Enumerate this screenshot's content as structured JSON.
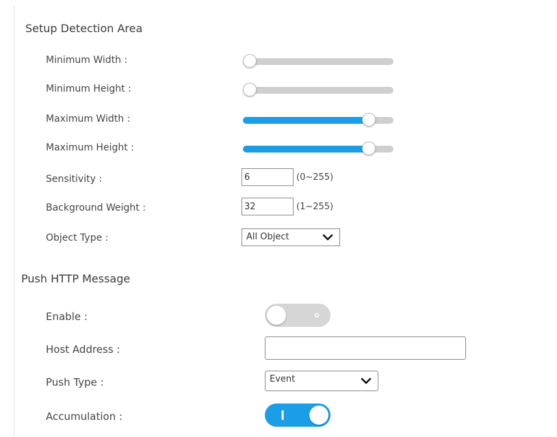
{
  "detection": {
    "title": "Setup Detection Area",
    "min_width": {
      "label": "Minimum Width :",
      "value_fraction": 0.0
    },
    "min_height": {
      "label": "Minimum Height :",
      "value_fraction": 0.0
    },
    "max_width": {
      "label": "Maximum Width :",
      "value_fraction": 0.87
    },
    "max_height": {
      "label": "Maximum Height :",
      "value_fraction": 0.87
    },
    "sensitivity": {
      "label": "Sensitivity :",
      "value": "6",
      "range": "(0~255)"
    },
    "background_weight": {
      "label": "Background Weight :",
      "value": "32",
      "range": "(1~255)"
    },
    "object_type": {
      "label": "Object Type :",
      "value": "All Object"
    }
  },
  "push_http": {
    "title": "Push HTTP Message",
    "enable": {
      "label": "Enable :",
      "state": "off"
    },
    "host_address": {
      "label": "Host Address :",
      "value": ""
    },
    "push_type": {
      "label": "Push Type :",
      "value": "Event"
    },
    "accumulation": {
      "label": "Accumulation :",
      "state": "on"
    }
  },
  "colors": {
    "accent": "#1a9ee8",
    "track": "#cfcfcf",
    "toggle_off": "#d6d6d6"
  }
}
